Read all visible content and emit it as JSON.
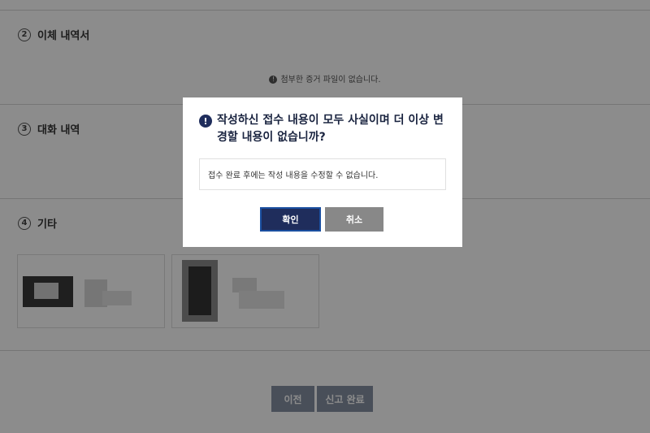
{
  "sections": [
    {
      "number": "2",
      "title": "이체 내역서"
    },
    {
      "number": "3",
      "title": "대화 내역"
    },
    {
      "number": "4",
      "title": "기타"
    }
  ],
  "notice": "첨부한 증거 파일이 없습니다.",
  "notice_icon": "info-icon",
  "bottom_buttons": {
    "prev": "이전",
    "submit": "신고 완료"
  },
  "modal": {
    "title": "작성하신 접수 내용이 모두 사실이며 더 이상 변경할 내용이 없습니까?",
    "message": "접수 완료 후에는 작성 내용을 수정할 수 없습니다.",
    "confirm": "확인",
    "cancel": "취소"
  },
  "colors": {
    "primary": "#1f2d5c",
    "cancel": "#888888",
    "overlay": "rgba(0,0,0,0.45)"
  }
}
